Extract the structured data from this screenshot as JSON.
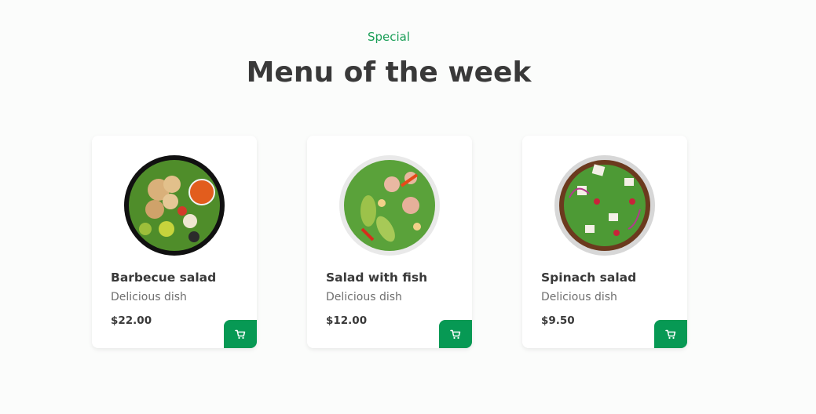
{
  "header": {
    "subtitle": "Special",
    "title": "Menu of the week"
  },
  "colors": {
    "accent": "#079954",
    "subtitle": "#1a9e57",
    "text": "#393939",
    "muted": "#6f6f6f"
  },
  "cards": [
    {
      "name": "Barbecue salad",
      "desc": "Delicious dish",
      "price": "$22.00",
      "cart_icon": "shopping-cart-icon"
    },
    {
      "name": "Salad with fish",
      "desc": "Delicious dish",
      "price": "$12.00",
      "cart_icon": "shopping-cart-icon"
    },
    {
      "name": "Spinach salad",
      "desc": "Delicious dish",
      "price": "$9.50",
      "cart_icon": "shopping-cart-icon"
    }
  ]
}
